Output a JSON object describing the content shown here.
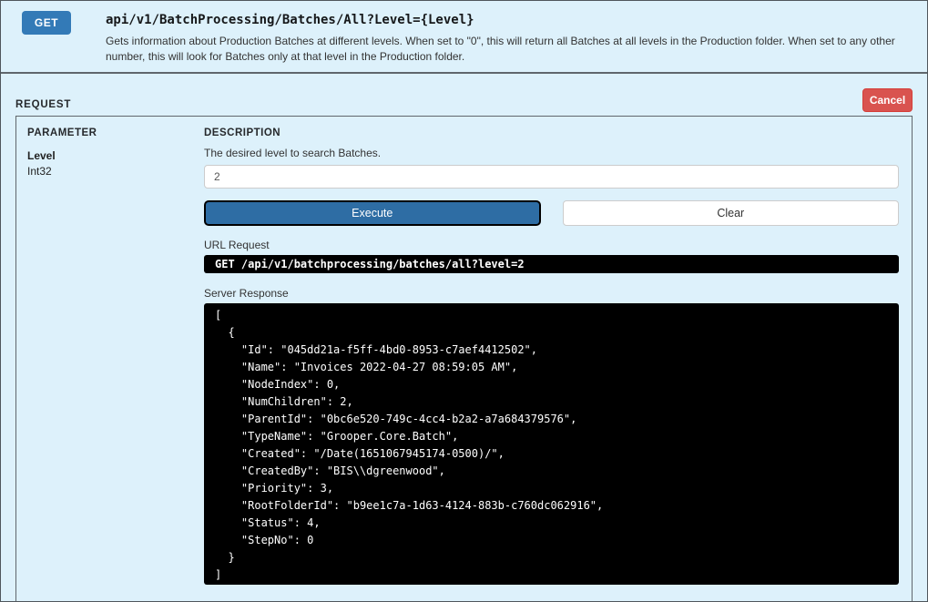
{
  "colors": {
    "c-bg": "#ddf1fb",
    "c-get": "#337ab7",
    "c-exec": "#2e6da4",
    "c-cancel": "#d9534f",
    "c-console": "#000000"
  },
  "operation": {
    "method": "GET",
    "path": "api/v1/BatchProcessing/Batches/All?Level={Level}",
    "description": "Gets information about Production Batches at different levels. When set to \"0\", this will return all Batches at all levels in the Production folder. When set to any other number, this will look for Batches only at that level in the Production folder."
  },
  "request": {
    "section_label": "REQUEST",
    "cancel_label": "Cancel",
    "param_header": "PARAMETER",
    "desc_header": "DESCRIPTION",
    "parameter": {
      "name": "Level",
      "type": "Int32",
      "description": "The desired level to search Batches.",
      "value": "2"
    },
    "execute_label": "Execute",
    "clear_label": "Clear",
    "url_request": {
      "label": "URL Request",
      "value": "GET /api/v1/batchprocessing/batches/all?level=2"
    },
    "server_response": {
      "label": "Server Response",
      "body": "[\n  {\n    \"Id\": \"045dd21a-f5ff-4bd0-8953-c7aef4412502\",\n    \"Name\": \"Invoices 2022-04-27 08:59:05 AM\",\n    \"NodeIndex\": 0,\n    \"NumChildren\": 2,\n    \"ParentId\": \"0bc6e520-749c-4cc4-b2a2-a7a684379576\",\n    \"TypeName\": \"Grooper.Core.Batch\",\n    \"Created\": \"/Date(1651067945174-0500)/\",\n    \"CreatedBy\": \"BIS\\\\dgreenwood\",\n    \"Priority\": 3,\n    \"RootFolderId\": \"b9ee1c7a-1d63-4124-883b-c760dc062916\",\n    \"Status\": 4,\n    \"StepNo\": 0\n  }\n]"
    }
  }
}
